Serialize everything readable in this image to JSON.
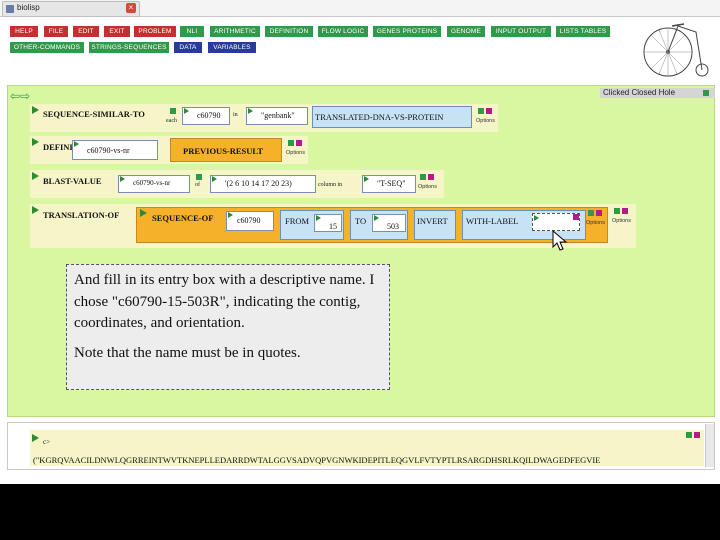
{
  "window": {
    "tab_title": "biolisp"
  },
  "menu": {
    "row1": [
      "HELP",
      "FILE",
      "EDIT",
      "EXIT",
      "PROBLEM",
      "NLI",
      "ARITHMETIC",
      "DEFINITION",
      "FLOW LOGIC",
      "GENES PROTEINS",
      "GENOME",
      "INPUT OUTPUT",
      "LISTS TABLES"
    ],
    "row2": [
      "OTHER-COMMANDS",
      "STRINGS-SEQUENCES",
      "DATA",
      "VARIABLES"
    ]
  },
  "workspace": {
    "clicked_closed_hole": "Clicked Closed Hole",
    "row1": {
      "keyword": "SEQUENCE-SIMILAR-TO",
      "each": "each",
      "arg1": "c60790",
      "in": "in",
      "arg2": "\"genbank\"",
      "protein": "TRANSLATED-DNA-VS-PROTEIN",
      "options": "Options"
    },
    "row2": {
      "keyword": "DEFINE",
      "name": "c60790-vs-nr",
      "result": "PREVIOUS-RESULT",
      "options": "Options"
    },
    "row3": {
      "keyword": "BLAST-VALUE",
      "arg1": "c60790-vs-nr",
      "of": "of",
      "list": "'(2 6 10 14 17 20 23)",
      "seq_label": "column in",
      "seq": "\"T-SEQ\"",
      "options": "Options"
    },
    "row4": {
      "keyword": "TRANSLATION-OF",
      "seq_kw": "SEQUENCE-OF",
      "seq_arg": "c60790",
      "from_kw": "FROM",
      "from_val": "15",
      "to_kw": "TO",
      "to_val": "503",
      "invert": "INVERT",
      "label_kw": "WITH-LABEL",
      "options_a": "Options",
      "options_b": "Options"
    }
  },
  "tooltip": {
    "para1": "And fill in its entry box with a descriptive name. I chose \"c60790-15-503R\", indicating the contig, coordinates, and orientation.",
    "para2": "Note that the name must be in quotes."
  },
  "result": {
    "label": "c>",
    "sequence": "(\"KGRQVAACILDNWLQGRREINTWVTKNEPLLEDARRDWTALGGVSADVQPVGNWKIDEPITLEQGVLFVTYPTLRSARGDHSRLKQILDWAGEDFEGVIE"
  },
  "colors": {
    "workspace": "#d9f7a0",
    "menu_red": "#c4302f",
    "menu_green": "#2f9a4a",
    "menu_blue": "#283a9a",
    "orange": "#f5b12a"
  }
}
